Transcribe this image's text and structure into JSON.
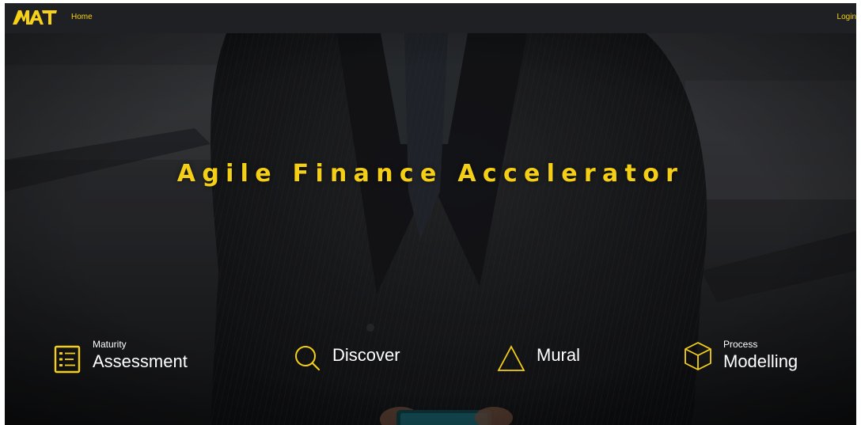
{
  "nav": {
    "logo_text": "MAT",
    "home_label": "Home",
    "login_label": "Login"
  },
  "hero": {
    "title": "Agile Finance Accelerator"
  },
  "features": [
    {
      "small": "Maturity",
      "big": "Assessment",
      "icon": "checklist-icon"
    },
    {
      "small": "",
      "big": "Discover",
      "icon": "search-icon"
    },
    {
      "small": "",
      "big": "Mural",
      "icon": "triangle-icon"
    },
    {
      "small": "Process",
      "big": "Modelling",
      "icon": "cube-icon"
    }
  ],
  "colors": {
    "accent": "#f5cf16",
    "navbar": "#1f2023",
    "text": "#ffffff"
  }
}
